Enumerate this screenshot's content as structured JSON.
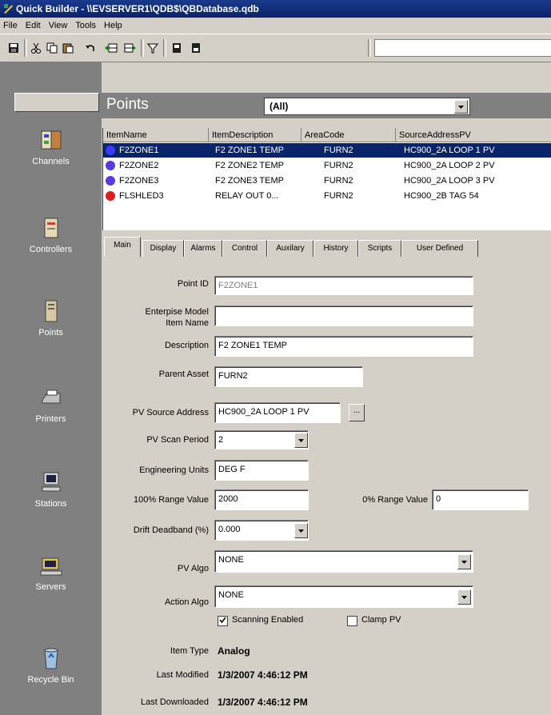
{
  "window": {
    "title": "Quick Builder - \\\\EVSERVER1\\QDB$\\QBDatabase.qdb"
  },
  "menu": [
    "File",
    "Edit",
    "View",
    "Tools",
    "Help"
  ],
  "nav": [
    {
      "label": "Channels",
      "icon": "channels-icon"
    },
    {
      "label": "Controllers",
      "icon": "controller-icon"
    },
    {
      "label": "Points",
      "icon": "points-icon"
    },
    {
      "label": "Printers",
      "icon": "printer-icon"
    },
    {
      "label": "Stations",
      "icon": "station-icon"
    },
    {
      "label": "Servers",
      "icon": "server-icon"
    },
    {
      "label": "Recycle Bin",
      "icon": "recycle-bin-icon"
    }
  ],
  "points": {
    "title": "Points",
    "filter": "(All)"
  },
  "list": {
    "columns": [
      "ItemName",
      "ItemDescription",
      "AreaCode",
      "SourceAddressPV"
    ],
    "rows": [
      {
        "name": "F2ZONE1",
        "desc": "F2 ZONE1 TEMP",
        "area": "FURN2",
        "source": "HC900_2A LOOP 1 PV",
        "status_color": "#3a3aff",
        "selected": true
      },
      {
        "name": "F2ZONE2",
        "desc": "F2 ZONE2 TEMP",
        "area": "FURN2",
        "source": "HC900_2A LOOP 2 PV",
        "status_color": "#5a3ad8"
      },
      {
        "name": "F2ZONE3",
        "desc": "F2 ZONE3 TEMP",
        "area": "FURN2",
        "source": "HC900_2A LOOP 3 PV",
        "status_color": "#5a3ad8"
      },
      {
        "name": "FLSHLED3",
        "desc": "RELAY OUT 0...",
        "area": "FURN2",
        "source": "HC900_2B TAG 54",
        "status_color": "#d81e1e"
      }
    ]
  },
  "tabs": [
    "Main",
    "Display",
    "Alarms",
    "Control",
    "Auxilary",
    "History",
    "Scripts",
    "User Defined"
  ],
  "form": {
    "point_id_label": "Point ID",
    "point_id": "F2ZONE1",
    "enterprise_label_1": "Enterpise Model",
    "enterprise_label_2": "Item Name",
    "enterprise": "",
    "description_label": "Description",
    "description": "F2 ZONE1 TEMP",
    "parent_asset_label": "Parent Asset",
    "parent_asset": "FURN2",
    "pv_source_label": "PV Source Address",
    "pv_source": "HC900_2A LOOP 1 PV",
    "browse_label": "...",
    "pv_scan_label": "PV Scan Period",
    "pv_scan": "2",
    "eng_units_label": "Engineering Units",
    "eng_units": "DEG F",
    "range100_label": "100% Range Value",
    "range100": "2000",
    "range0_label": "0% Range Value",
    "range0": "0",
    "drift_label": "Drift Deadband (%)",
    "drift": "0.000",
    "pv_algo_label": "PV Algo",
    "pv_algo": "NONE",
    "action_algo_label": "Action Algo",
    "action_algo": "NONE",
    "scanning_label": "Scanning Enabled",
    "scanning_checked": true,
    "clamp_label": "Clamp PV",
    "clamp_checked": false,
    "item_type_label": "Item Type",
    "item_type": "Analog",
    "last_modified_label": "Last Modified",
    "last_modified": "1/3/2007 4:46:12 PM",
    "last_downloaded_label": "Last Downloaded",
    "last_downloaded": "1/3/2007 4:46:12 PM"
  }
}
